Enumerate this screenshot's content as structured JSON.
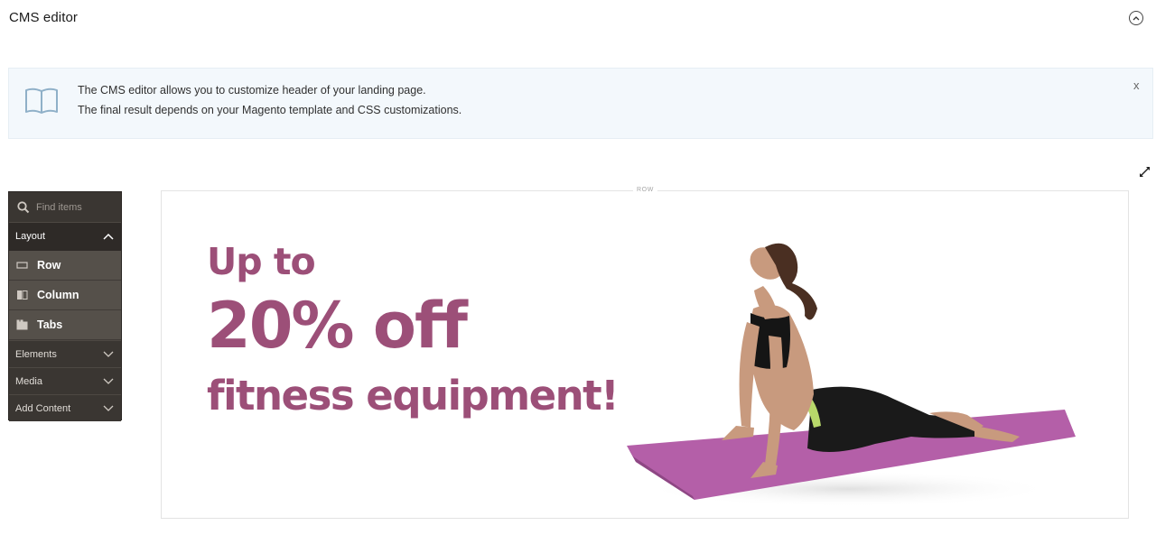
{
  "header": {
    "title": "CMS editor",
    "collapse_icon": "chevron-up-circle-icon"
  },
  "notice": {
    "icon": "book-icon",
    "line1": "The CMS editor allows you to customize header of your landing page.",
    "line2": "The final result depends on your Magento template and CSS customizations.",
    "close_label": "x"
  },
  "toolbar": {
    "fullscreen_icon": "expand-icon"
  },
  "panel": {
    "search_placeholder": "Find items",
    "groups": [
      {
        "label": "Layout",
        "expanded": true,
        "items": [
          {
            "label": "Row",
            "icon": "row-icon"
          },
          {
            "label": "Column",
            "icon": "column-icon"
          },
          {
            "label": "Tabs",
            "icon": "tabs-icon"
          }
        ]
      },
      {
        "label": "Elements",
        "expanded": false
      },
      {
        "label": "Media",
        "expanded": false
      },
      {
        "label": "Add Content",
        "expanded": false
      }
    ]
  },
  "stage": {
    "row_label": "ROW",
    "banner": {
      "line1": "Up to",
      "line2": "20% off",
      "line3": "fitness equipment!",
      "text_color": "#9c4f78",
      "image": "woman doing cobra yoga pose on purple mat"
    }
  },
  "colors": {
    "panel_bg": "#3a3632",
    "panel_item_bg": "#55504a",
    "notice_bg": "#f3f8fc",
    "accent": "#9c4f78",
    "mat": "#b45fa8"
  }
}
